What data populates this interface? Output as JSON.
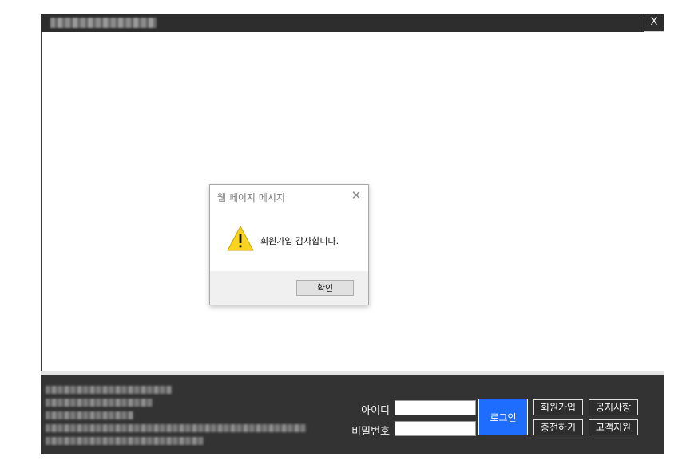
{
  "window": {
    "title": "■■■■ ■ ■■■■■ ■■■■■",
    "close_label": "X"
  },
  "footer": {
    "company_lines": [
      "■■■■■■■■■■■■■ ■■■",
      "■■■■■■■■■■■■■",
      "■■■■■■■■ ■■",
      "■■■■■■■■■■■■■■■■■■■■■■■■■■■■■■■■■■■■",
      "■■■■■■■■■■■■■■■■■■■■■■"
    ],
    "id_label": "아이디",
    "pw_label": "비밀번호",
    "id_value": "",
    "pw_value": "",
    "login_button": "로그인",
    "join_button": "회원가입",
    "charge_button": "충전하기",
    "notice_button": "공지사항",
    "support_button": "고객지원"
  },
  "dialog": {
    "title": "웹 페이지 메시지",
    "close_label": "✕",
    "message": "회원가입 감사합니다.",
    "ok_button": "확인",
    "icon": "warning-icon",
    "icon_color": "#f9d41f"
  },
  "colors": {
    "titlebar": "#2d2d2d",
    "footer": "#333333",
    "login_accent": "#1f6dff"
  }
}
